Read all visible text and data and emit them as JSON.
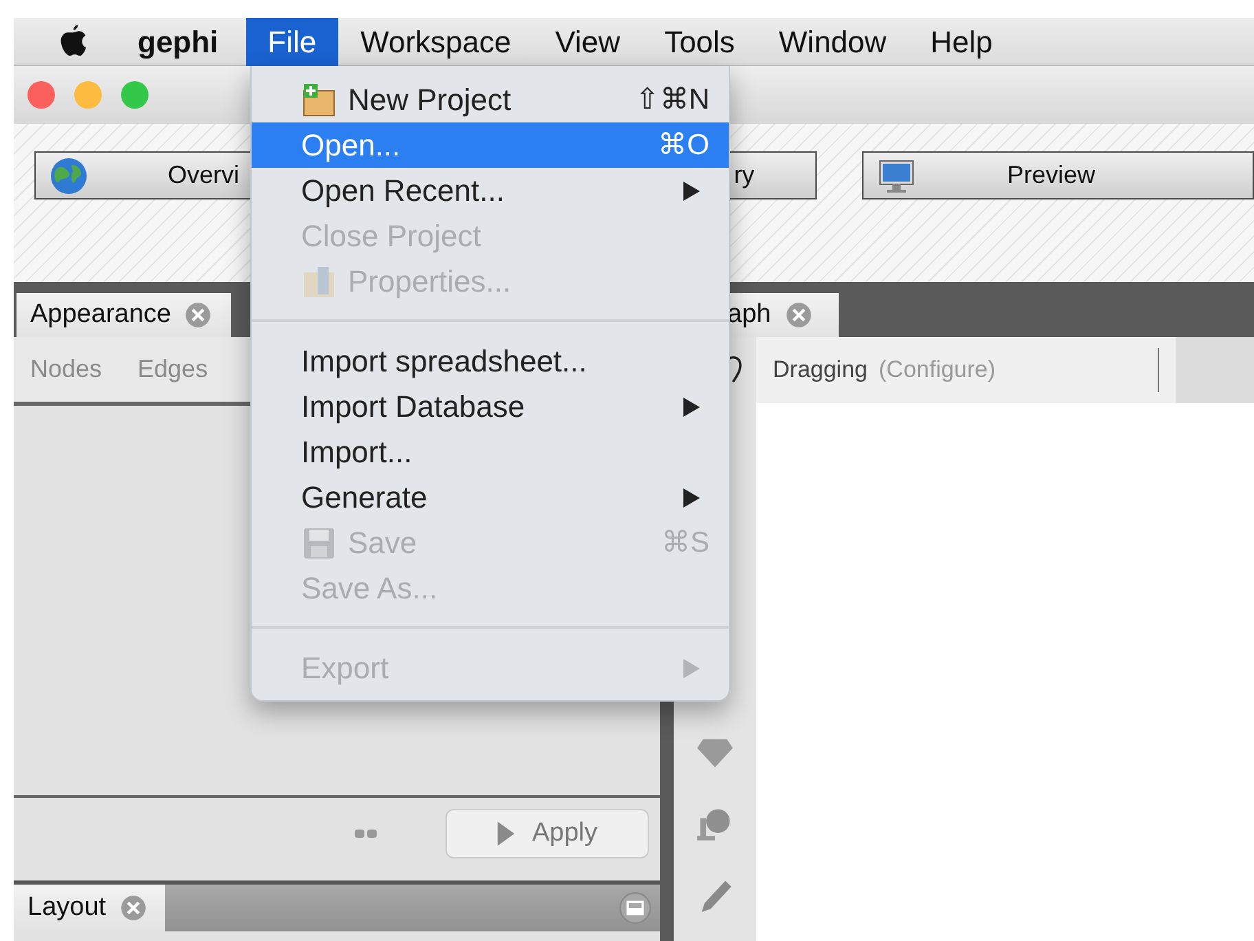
{
  "menu_bar": {
    "items": [
      {
        "label": "gephi",
        "kind": "app",
        "selected": false
      },
      {
        "label": "File",
        "kind": "menu",
        "selected": true
      },
      {
        "label": "Workspace",
        "kind": "menu",
        "selected": false
      },
      {
        "label": "View",
        "kind": "menu",
        "selected": false
      },
      {
        "label": "Tools",
        "kind": "menu",
        "selected": false
      },
      {
        "label": "Window",
        "kind": "menu",
        "selected": false
      },
      {
        "label": "Help",
        "kind": "menu",
        "selected": false
      }
    ]
  },
  "toolbar": {
    "buttons": [
      {
        "label": "Overvi"
      },
      {
        "label": "ry"
      },
      {
        "label": "Preview"
      }
    ]
  },
  "left_panel": {
    "tab": "Appearance",
    "subtabs": [
      "Nodes",
      "Edges"
    ],
    "apply_button": "Apply"
  },
  "layout_panel": {
    "tab": "Layout"
  },
  "graph_panel": {
    "tab": "aph",
    "tool": "Dragging",
    "tool_hint": "(Configure)"
  },
  "file_menu": {
    "items": [
      {
        "kind": "item",
        "label": "New Project",
        "shortcut": "⇧⌘N",
        "submenu": false,
        "disabled": false,
        "selected": false
      },
      {
        "kind": "item",
        "label": "Open...",
        "shortcut": "⌘O",
        "submenu": false,
        "disabled": false,
        "selected": true
      },
      {
        "kind": "item",
        "label": "Open Recent...",
        "submenu": true,
        "disabled": false,
        "selected": false
      },
      {
        "kind": "item",
        "label": "Close Project",
        "submenu": false,
        "disabled": true,
        "selected": false
      },
      {
        "kind": "item",
        "label": "Properties...",
        "submenu": false,
        "disabled": true,
        "selected": false
      },
      {
        "kind": "separator"
      },
      {
        "kind": "item",
        "label": "Import spreadsheet...",
        "submenu": false,
        "disabled": false,
        "selected": false
      },
      {
        "kind": "item",
        "label": "Import Database",
        "submenu": true,
        "disabled": false,
        "selected": false
      },
      {
        "kind": "item",
        "label": "Import...",
        "submenu": false,
        "disabled": false,
        "selected": false
      },
      {
        "kind": "item",
        "label": "Generate",
        "submenu": true,
        "disabled": false,
        "selected": false
      },
      {
        "kind": "item",
        "label": "Save",
        "shortcut": "⌘S",
        "submenu": false,
        "disabled": true,
        "selected": false
      },
      {
        "kind": "item",
        "label": "Save As...",
        "submenu": false,
        "disabled": true,
        "selected": false
      },
      {
        "kind": "separator"
      },
      {
        "kind": "item",
        "label": "Export",
        "submenu": true,
        "disabled": true,
        "selected": false
      }
    ]
  }
}
